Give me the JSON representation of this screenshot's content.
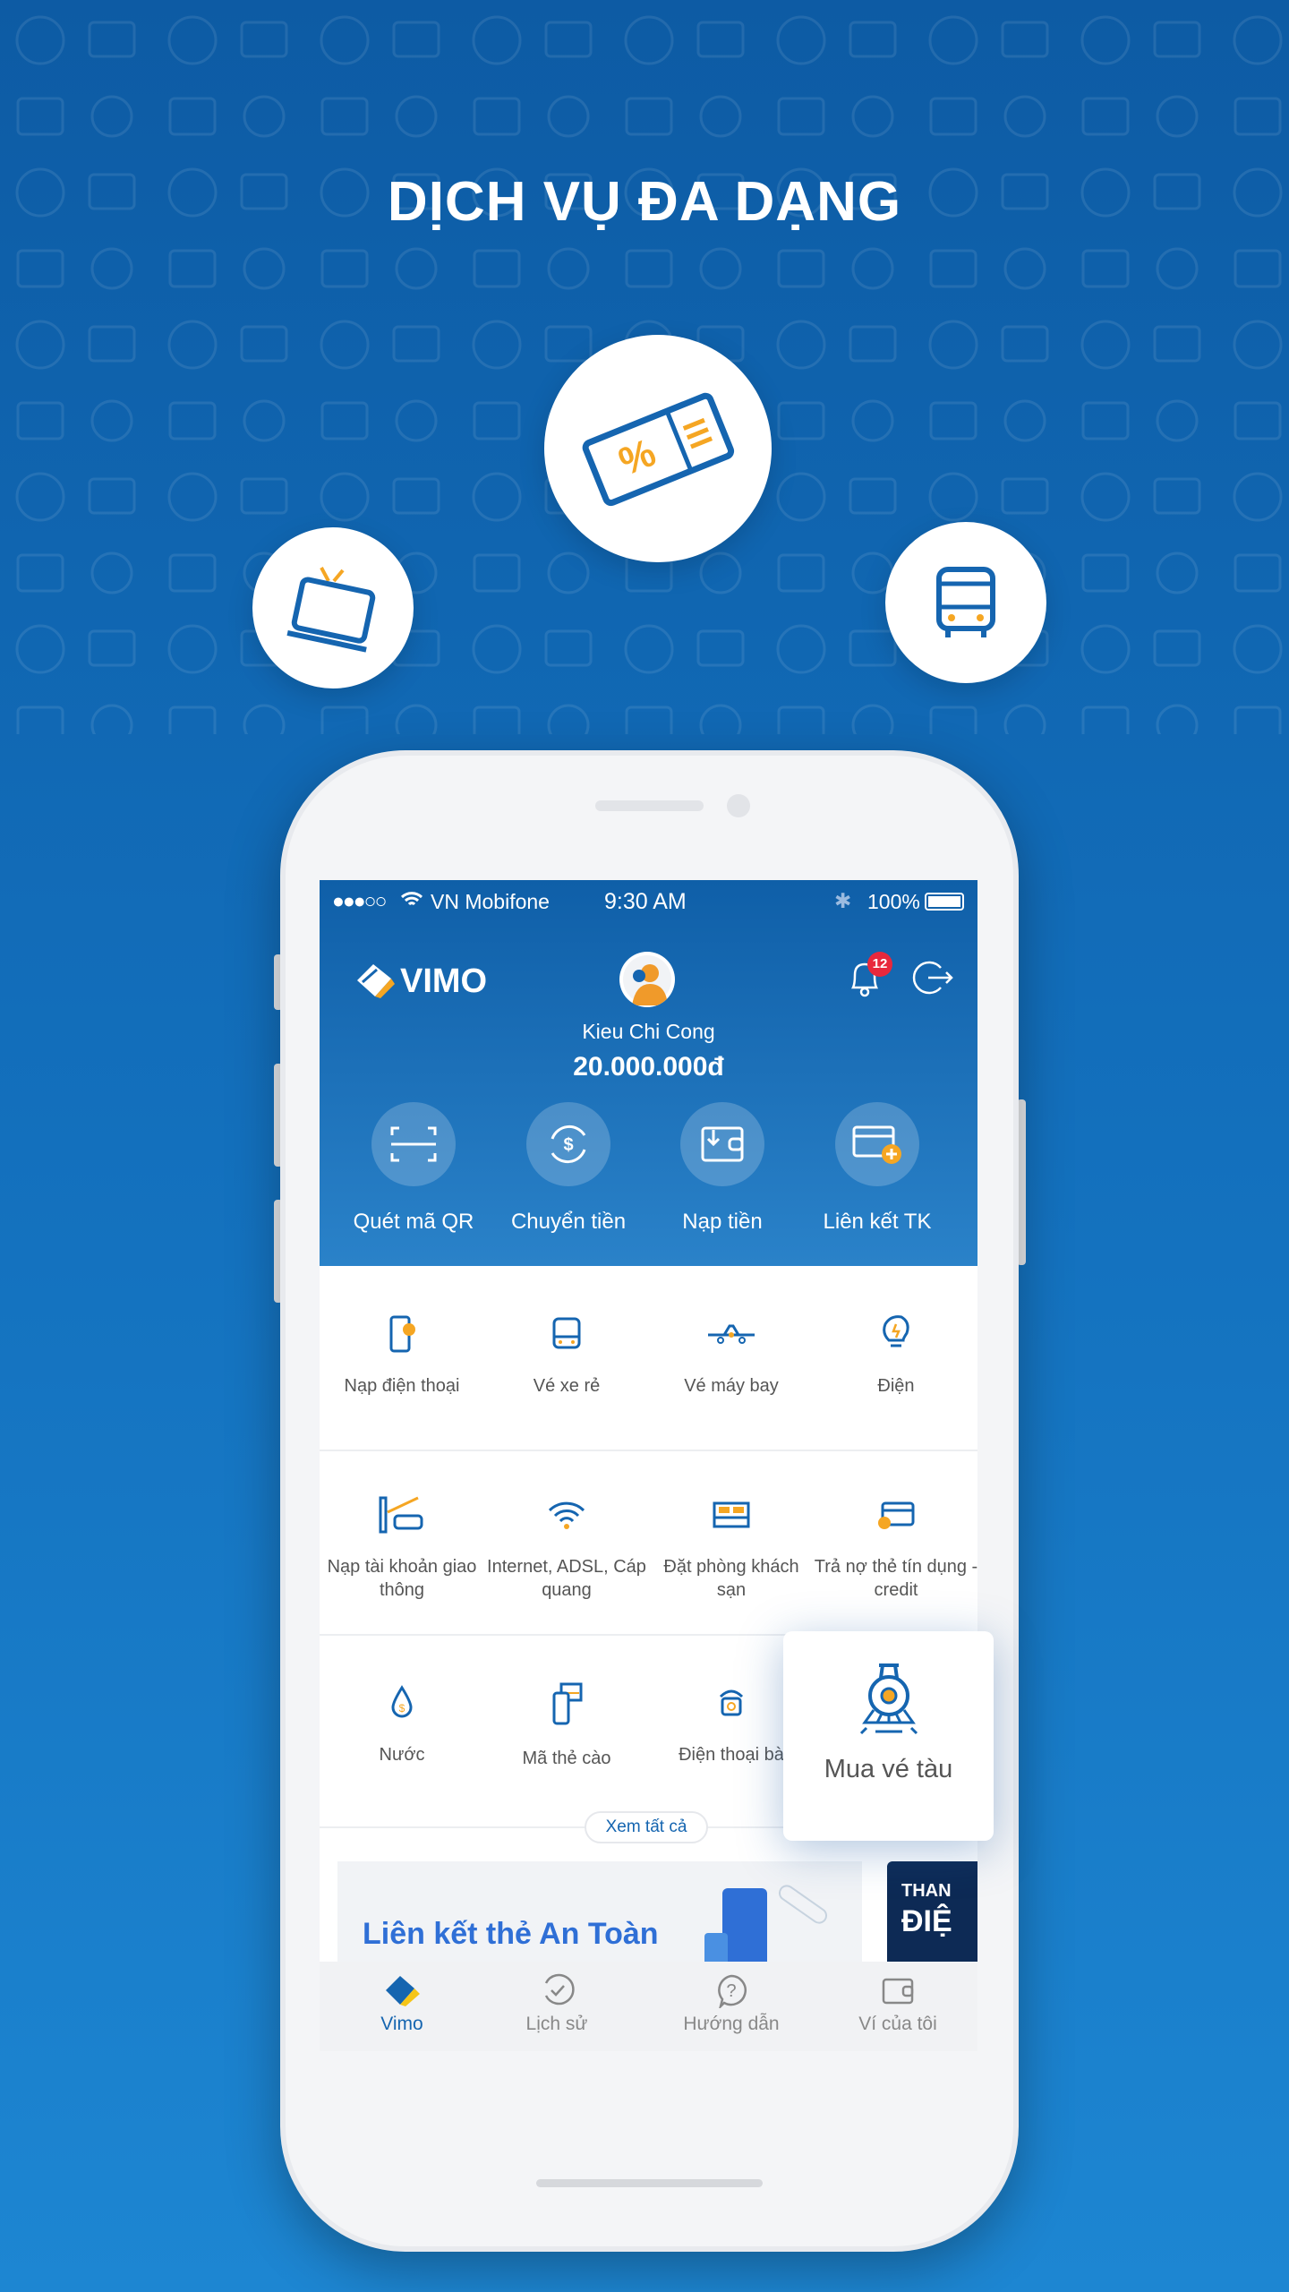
{
  "headline": "DỊCH VỤ ĐA DẠNG",
  "colors": {
    "brand_blue": "#1565b0",
    "accent_orange": "#f5a623",
    "badge_red": "#e8283c"
  },
  "status_bar": {
    "carrier": "VN Mobifone",
    "time": "9:30 AM",
    "battery": "100%"
  },
  "header": {
    "brand": "VIMO",
    "user_name": "Kieu Chi Cong",
    "balance": "20.000.000đ",
    "notification_count": "12"
  },
  "actions": [
    {
      "label": "Quét mã QR",
      "icon": "qr-scan-icon"
    },
    {
      "label": "Chuyển tiền",
      "icon": "money-transfer-icon"
    },
    {
      "label": "Nạp tiền",
      "icon": "wallet-topup-icon"
    },
    {
      "label": "Liên kết TK",
      "icon": "link-card-icon"
    }
  ],
  "services": [
    {
      "label": "Nạp điện thoại",
      "icon": "phone-topup-icon"
    },
    {
      "label": "Vé xe rẻ",
      "icon": "bus-icon"
    },
    {
      "label": "Vé máy bay",
      "icon": "plane-icon"
    },
    {
      "label": "Điện",
      "icon": "lightbulb-icon"
    },
    {
      "label": "Nạp tài khoản giao thông",
      "icon": "toll-icon"
    },
    {
      "label": "Internet, ADSL, Cáp quang",
      "icon": "wifi-icon"
    },
    {
      "label": "Đặt phòng khách sạn",
      "icon": "bed-icon"
    },
    {
      "label": "Trả nợ thẻ tín dụng - credit",
      "icon": "credit-card-icon"
    },
    {
      "label": "Nước",
      "icon": "water-drop-icon"
    },
    {
      "label": "Mã thẻ cào",
      "icon": "scratch-card-icon"
    },
    {
      "label": "Điện thoại bà",
      "icon": "landline-phone-icon"
    }
  ],
  "see_all": "Xem tất cả",
  "popup": {
    "label": "Mua vé tàu",
    "icon": "train-icon"
  },
  "banner": {
    "title": "Liên kết thẻ An Toàn",
    "side_text_1": "THAN",
    "side_text_2": "ĐIỆ"
  },
  "bottom_nav": [
    {
      "label": "Vimo",
      "active": true
    },
    {
      "label": "Lịch sử"
    },
    {
      "label": "Hướng dẫn"
    },
    {
      "label": "Ví của tôi"
    }
  ]
}
